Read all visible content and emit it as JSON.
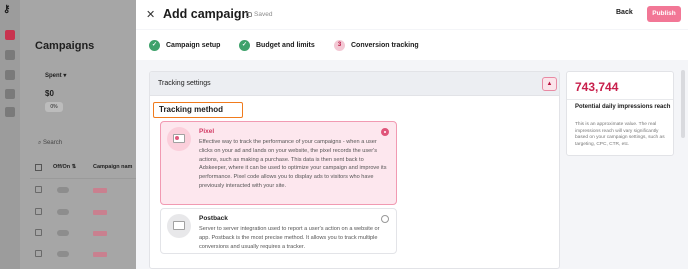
{
  "background": {
    "page_title": "Campaigns",
    "spent_label": "Spent ▾",
    "spent_value": "$0",
    "spent_pct": "0%",
    "search_placeholder": "Search",
    "col_onoff": "Off/On ⇅",
    "col_name": "Campaign nam"
  },
  "header": {
    "title": "Add campaign",
    "saved": "Saved",
    "back": "Back",
    "publish": "Publish"
  },
  "steps": [
    {
      "num": "✓",
      "label": "Campaign setup",
      "state": "done"
    },
    {
      "num": "✓",
      "label": "Budget and limits",
      "state": "done"
    },
    {
      "num": "3",
      "label": "Conversion tracking",
      "state": "current"
    }
  ],
  "tracking": {
    "section_title": "Tracking settings",
    "method_title": "Tracking method",
    "options": [
      {
        "name": "Pixel",
        "description": "Effective way to track the performance of your campaigns - when a user clicks on your ad and lands on your website, the pixel records the user's actions, such as making a purchase. This data is then sent back to Adskeeper, where it can be used to optimize your campaign and improve its performance. Pixel code allows you to display ads to visitors who have previously interacted with your site.",
        "selected": true
      },
      {
        "name": "Postback",
        "description": "Server to server integration used to report a user's action on a website or app. Postback is the most precise method. It allows you to track multiple conversions and usually requires a tracker.",
        "selected": false
      }
    ]
  },
  "reach": {
    "value": "743,744",
    "label": "Potential daily impressions reach",
    "note": "This is an approximate value. The real impressions reach will vary significantly based on your campaign settings, such as targeting, CPC, CTR, etc."
  },
  "colors": {
    "accent": "#c81f4b",
    "publish": "#f27796",
    "done": "#3fa26b",
    "highlight": "#f07b1d"
  }
}
